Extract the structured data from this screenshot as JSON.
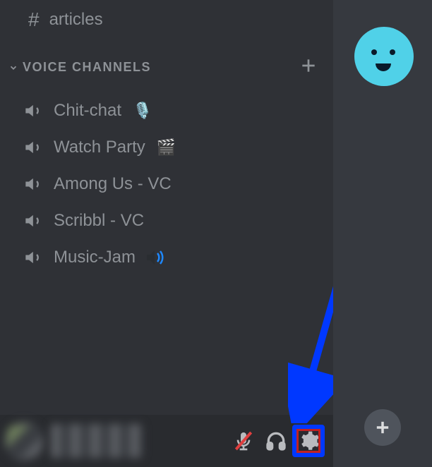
{
  "text_channel": {
    "name": "articles"
  },
  "category": {
    "label": "VOICE CHANNELS"
  },
  "voice_channels": [
    {
      "name": "Chit-chat",
      "emoji": "🎙️"
    },
    {
      "name": "Watch Party",
      "emoji": "🎬"
    },
    {
      "name": "Among Us - VC",
      "emoji": ""
    },
    {
      "name": "Scribbl - VC",
      "emoji": ""
    },
    {
      "name": "Music-Jam",
      "emoji": "",
      "has_loud_icon": true
    }
  ]
}
